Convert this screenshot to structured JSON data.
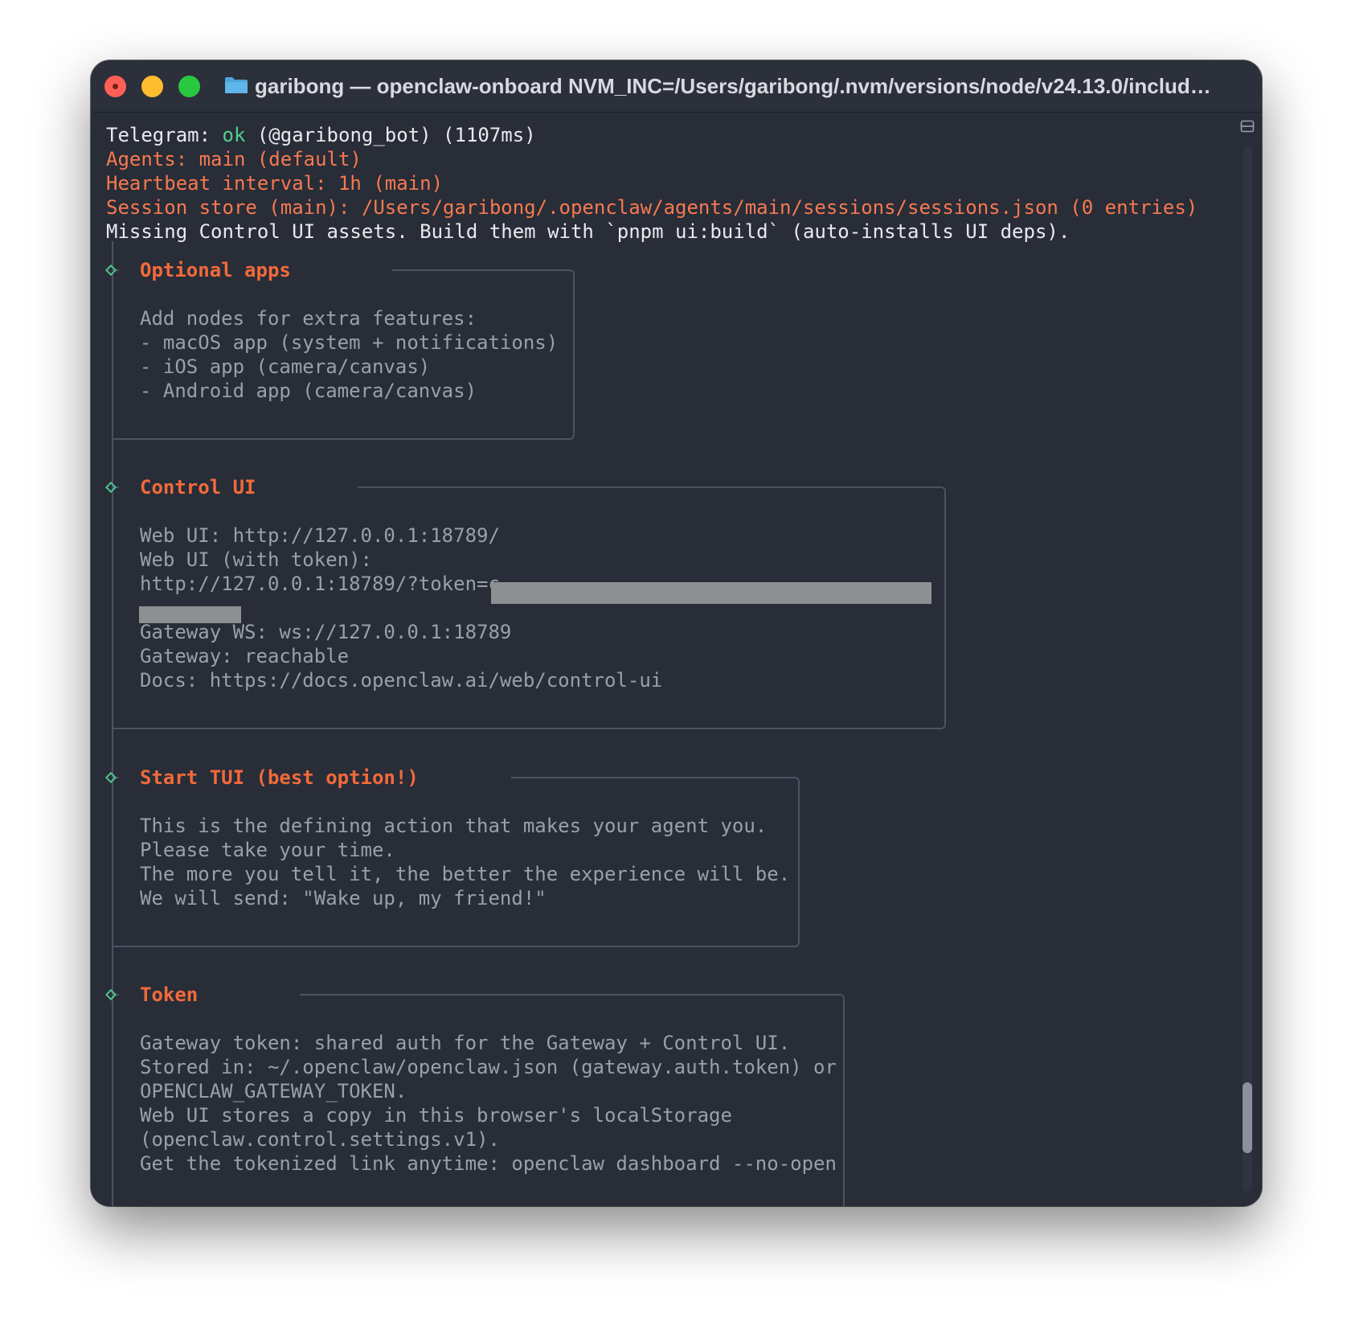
{
  "window": {
    "title": "garibong — openclaw-onboard NVM_INC=/Users/garibong/.nvm/versions/node/v24.13.0/includ…"
  },
  "icons": {
    "close": "close-light-icon",
    "minimize": "minimize-light-icon",
    "zoom": "zoom-light-icon",
    "folder": "folder-icon",
    "sidebar_toggle": "sidebar-toggle-icon",
    "step_marker": "diamond-icon"
  },
  "colors": {
    "background": "#282d38",
    "white_text": "#e8eaee",
    "orange_text": "#f7794f",
    "ok_green": "#4fd18b",
    "muted_text": "#9aa0aa",
    "header_text": "#f26a3a",
    "border": "#4a5363"
  },
  "status": {
    "telegram_prefix": "Telegram: ",
    "telegram_ok": "ok",
    "telegram_suffix": " (@garibong_bot) (1107ms)",
    "agents": "Agents: main (default)",
    "heartbeat": "Heartbeat interval: 1h (main)",
    "session_store": "Session store (main): /Users/garibong/.openclaw/agents/main/sessions/sessions.json (0 entries)",
    "missing_assets": "Missing Control UI assets. Build them with `pnpm ui:build` (auto-installs UI deps)."
  },
  "sections": {
    "optional_apps": {
      "title": "Optional apps",
      "lines": [
        "Add nodes for extra features:",
        "- macOS app (system + notifications)",
        "- iOS app (camera/canvas)",
        "- Android app (camera/canvas)"
      ]
    },
    "control_ui": {
      "title": "Control UI",
      "lines": [
        "Web UI: http://127.0.0.1:18789/",
        "Web UI (with token):",
        "http://127.0.0.1:18789/?token=c",
        "Gateway WS: ws://127.0.0.1:18789",
        "Gateway: reachable",
        "Docs: https://docs.openclaw.ai/web/control-ui"
      ]
    },
    "start_tui": {
      "title": "Start TUI (best option!)",
      "lines": [
        "This is the defining action that makes your agent you.",
        "Please take your time.",
        "The more you tell it, the better the experience will be.",
        "We will send: \"Wake up, my friend!\""
      ]
    },
    "token": {
      "title": "Token",
      "lines": [
        "Gateway token: shared auth for the Gateway + Control UI.",
        "Stored in: ~/.openclaw/openclaw.json (gateway.auth.token) or",
        "OPENCLAW_GATEWAY_TOKEN.",
        "Web UI stores a copy in this browser's localStorage",
        "(openclaw.control.settings.v1).",
        "Get the tokenized link anytime: openclaw dashboard --no-open"
      ]
    }
  },
  "scroll": {
    "position_fraction": 0.96
  }
}
